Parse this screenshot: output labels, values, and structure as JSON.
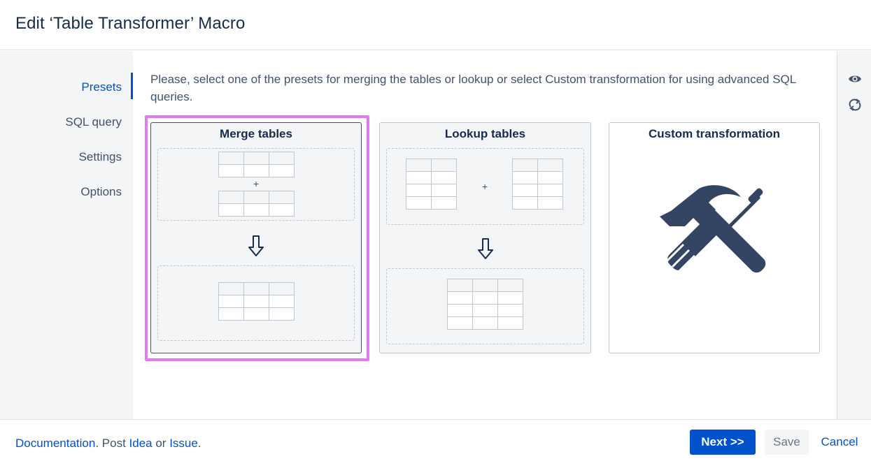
{
  "dialog": {
    "title": "Edit ‘Table Transformer’ Macro"
  },
  "sidebar": {
    "items": [
      {
        "label": "Presets",
        "active": true
      },
      {
        "label": "SQL query",
        "active": false
      },
      {
        "label": "Settings",
        "active": false
      },
      {
        "label": "Options",
        "active": false
      }
    ]
  },
  "main": {
    "intro": "Please, select one of the presets for merging the tables or lookup or select Custom transformation for using advanced SQL queries.",
    "presets": [
      {
        "title": "Merge tables",
        "selected": true
      },
      {
        "title": "Lookup tables",
        "selected": false
      },
      {
        "title": "Custom transformation",
        "selected": false
      }
    ],
    "plus_symbol": "+"
  },
  "rightbar": {
    "icons": [
      "eye-icon",
      "refresh-icon"
    ]
  },
  "footer": {
    "documentation": "Documentation",
    "post_text": ". Post ",
    "idea": "Idea",
    "or_text": " or ",
    "issue": "Issue",
    "end_text": ".",
    "next_label": "Next >>",
    "save_label": "Save",
    "cancel_label": "Cancel"
  },
  "colors": {
    "accent": "#0052cc",
    "highlight": "#e07bf0",
    "tool_icon": "#344563"
  }
}
